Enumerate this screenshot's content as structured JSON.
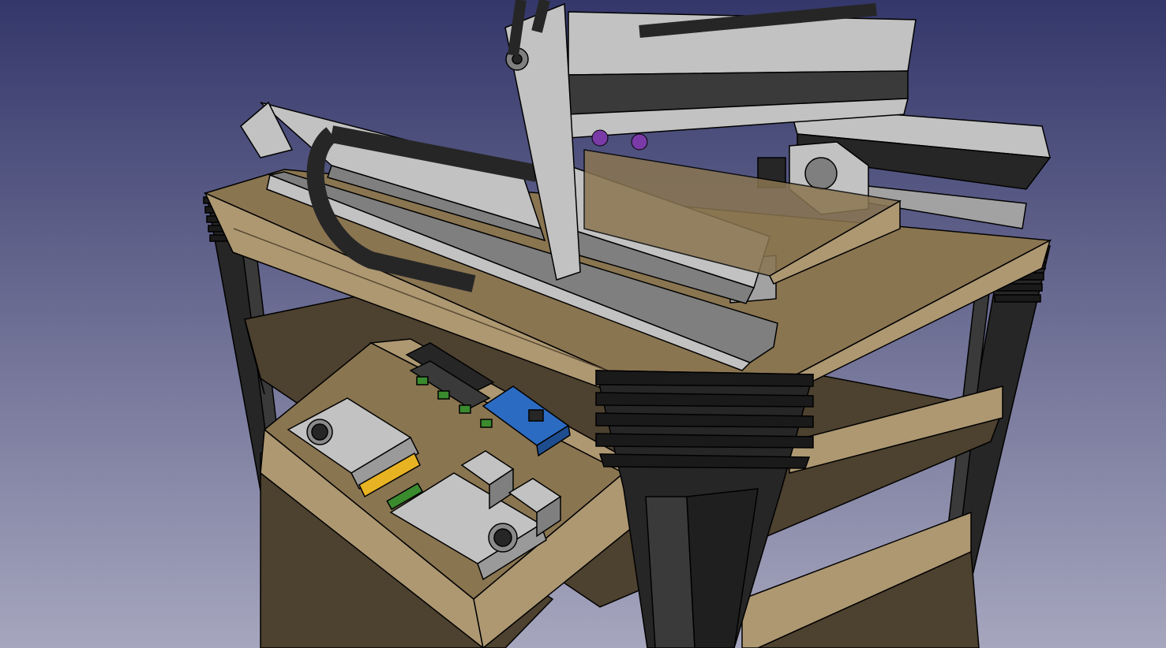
{
  "viewport": {
    "background_top": "#34376a",
    "background_bottom": "#a6a6be"
  },
  "colors": {
    "wood_top": "#8a7551",
    "wood_front": "#ad9872",
    "wood_dark": "#5a4a33",
    "wood_shelf": "#4d412f",
    "aluminum": "#c2c2c2",
    "aluminum_dark": "#7f7f7f",
    "black_part": "#262626",
    "board_blue": "#2c6bc2",
    "board_green": "#3a8a2e",
    "board_yellow": "#e8b322",
    "purple_part": "#7a3aa8"
  }
}
